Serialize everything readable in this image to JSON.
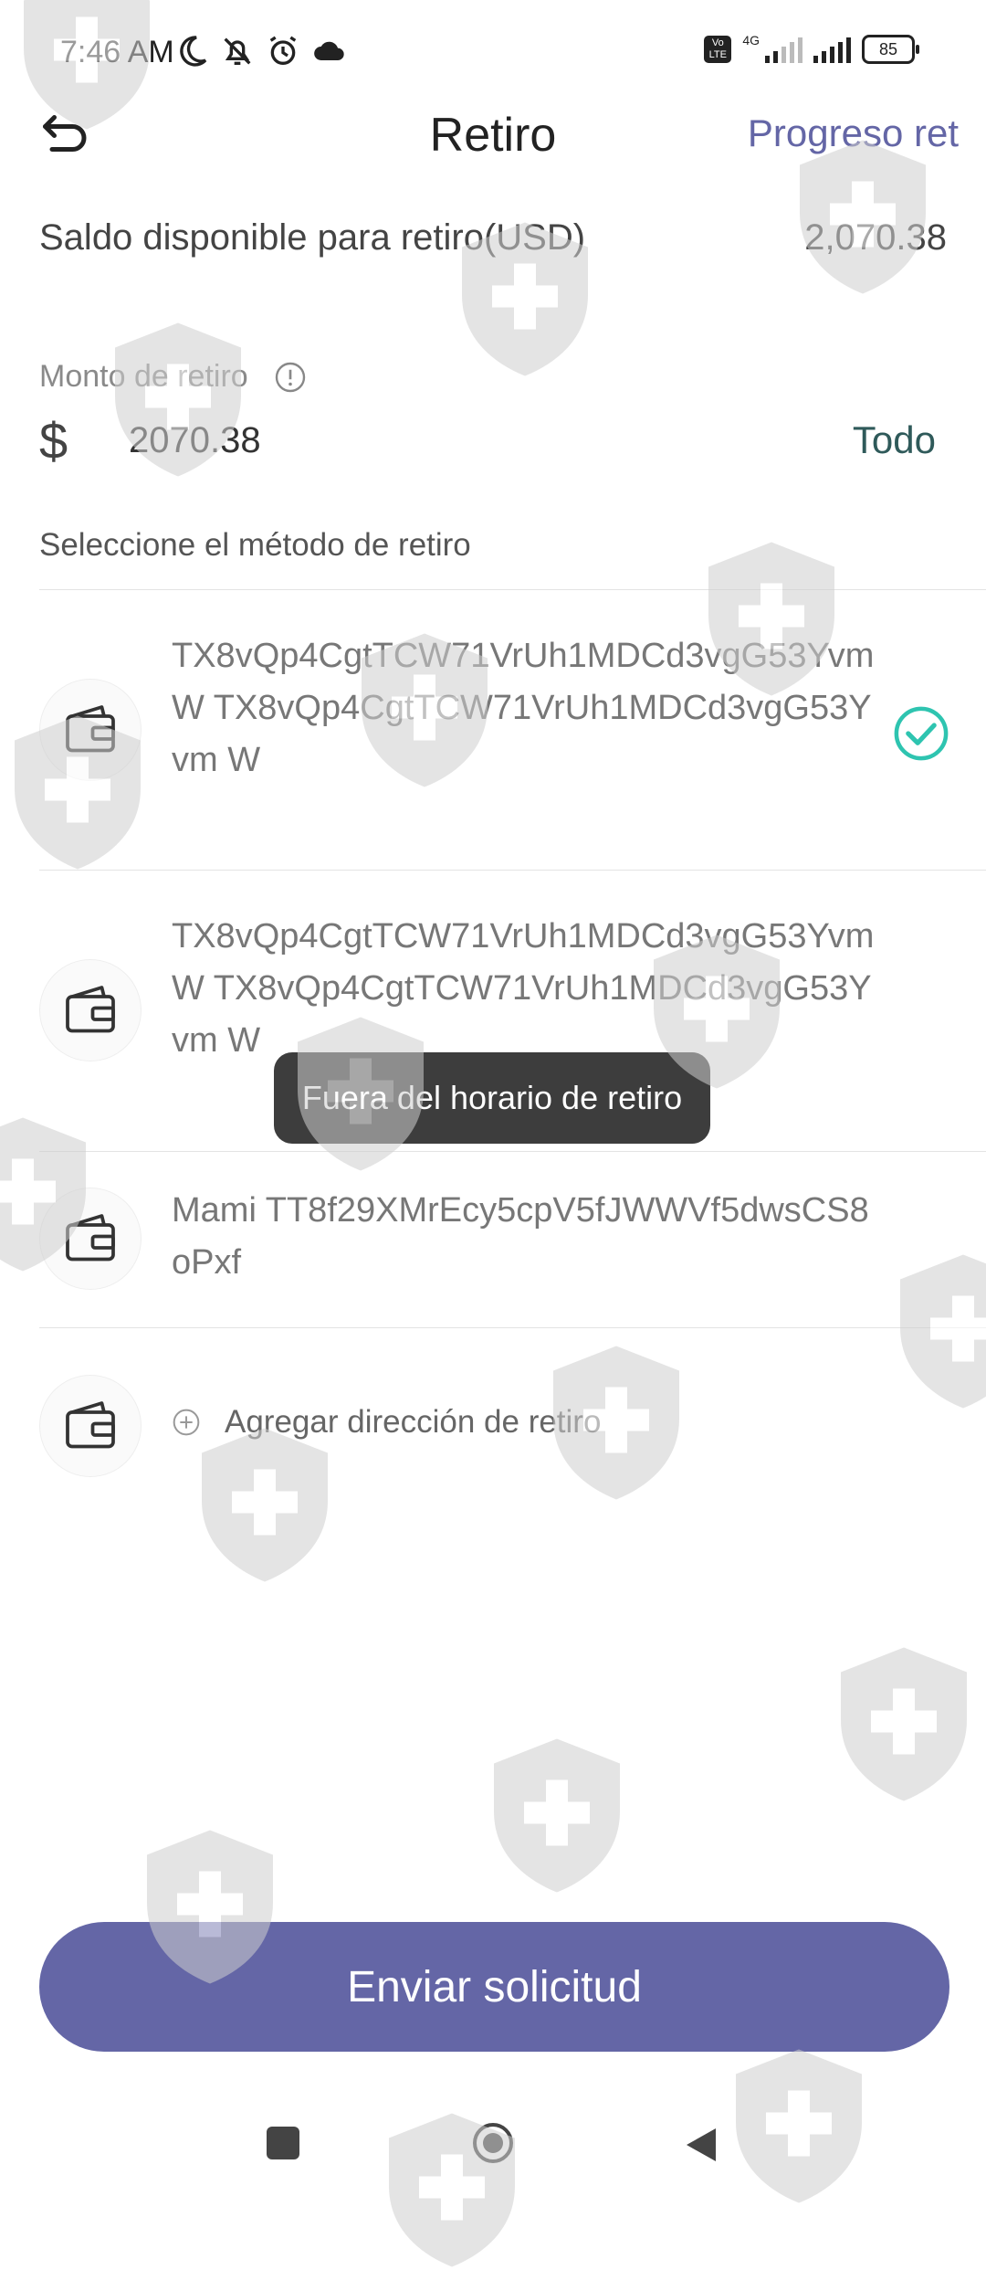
{
  "status_bar": {
    "time": "7:46 AM",
    "volte": "Vo LTE",
    "network": "4G",
    "battery": "85"
  },
  "header": {
    "title": "Retiro",
    "progress_link": "Progreso ret"
  },
  "balance": {
    "label": "Saldo disponible para retiro(USD)",
    "value": "2,070.38"
  },
  "amount": {
    "label": "Monto de retiro",
    "currency_symbol": "$",
    "value": "2070.38",
    "all_button": "Todo"
  },
  "method": {
    "label": "Seleccione el método de retiro",
    "addresses": [
      {
        "text": "TX8vQp4CgtTCW71VrUh1MDCd3vgG53Yvm W TX8vQp4CgtTCW71VrUh1MDCd3vgG53Yvm W",
        "selected": true
      },
      {
        "text": "TX8vQp4CgtTCW71VrUh1MDCd3vgG53Yvm W TX8vQp4CgtTCW71VrUh1MDCd3vgG53Yvm W",
        "selected": false
      },
      {
        "text": "Mami TT8f29XMrEcy5cpV5fJWWVf5dwsCS8oPxf",
        "selected": false
      }
    ],
    "add_label": "Agregar dirección de retiro"
  },
  "toast": "Fuera del horario de retiro",
  "submit_label": "Enviar solicitud",
  "colors": {
    "accent": "#6466a6",
    "check": "#2ec4b0",
    "toast_bg": "#3d3d3d"
  },
  "icons": [
    "back-icon",
    "info-icon",
    "wallet-icon",
    "check-circle-icon",
    "add-circle-icon",
    "shield-cross-watermark"
  ]
}
